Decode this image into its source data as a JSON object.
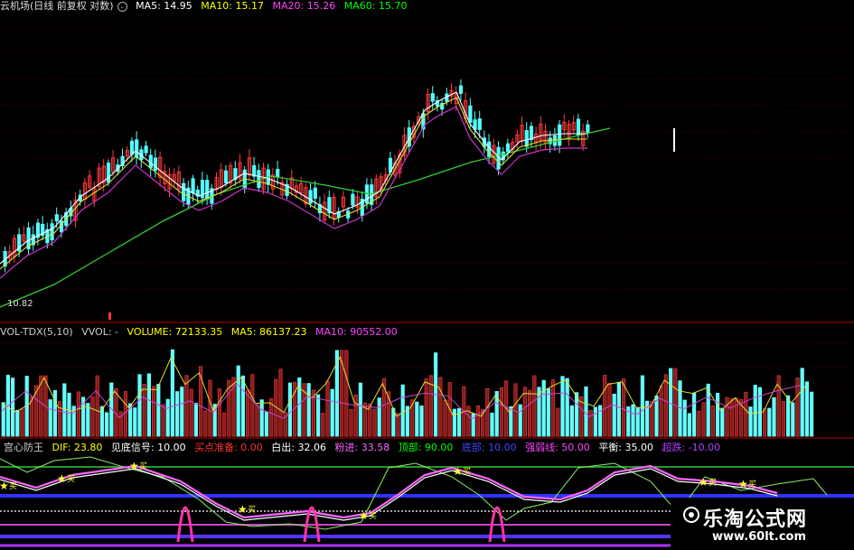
{
  "main_header": {
    "title": "云机场(日线 前复权 对数)",
    "toggle_icon": "chevron-down-icon",
    "ma5": "MA5: 14.95",
    "ma10": "MA10: 15.17",
    "ma20": "MA20: 15.26",
    "ma60": "MA60: 15.70",
    "low_label": "10.82",
    "colors": {
      "ma5": "#ffffff",
      "ma10": "#ffff00",
      "ma20": "#ff00ff",
      "ma60": "#00ff00"
    }
  },
  "vol_header": {
    "name": "VOL-TDX(5,10)",
    "vvol": "VVOL: -",
    "volume": "VOLUME: 72133.35",
    "ma5": "MA5: 86137.23",
    "ma10": "MA10: 90552.00"
  },
  "ind_header": {
    "name": "宫心防王",
    "dif": "DIF: 23.80",
    "signal": "见底信号: 10.00",
    "buy_prep": "买点准备: 0.00",
    "whiteout": "白出: 32.06",
    "fan_in": "粉进: 33.58",
    "top": "顶部: 90.00",
    "bottom": "底部: 10.00",
    "strong_weak": "强弱线: 50.00",
    "balance": "平衡: 35.00",
    "oversold": "超跌: -10.00"
  },
  "signal_label": "买",
  "watermark": {
    "brand": "乐淘公式网",
    "url": "www.60lt.com"
  }
}
